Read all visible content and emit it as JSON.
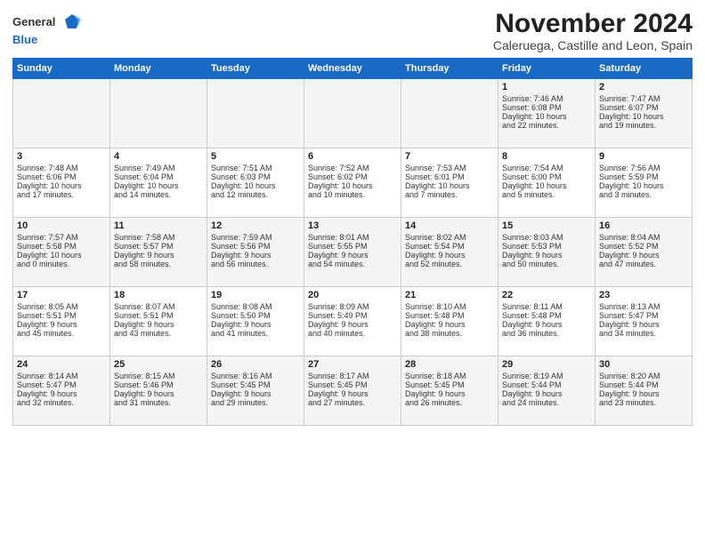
{
  "logo": {
    "general": "General",
    "blue": "Blue"
  },
  "header": {
    "month_title": "November 2024",
    "subtitle": "Caleruega, Castille and Leon, Spain"
  },
  "weekdays": [
    "Sunday",
    "Monday",
    "Tuesday",
    "Wednesday",
    "Thursday",
    "Friday",
    "Saturday"
  ],
  "weeks": [
    [
      {
        "day": "",
        "text": ""
      },
      {
        "day": "",
        "text": ""
      },
      {
        "day": "",
        "text": ""
      },
      {
        "day": "",
        "text": ""
      },
      {
        "day": "",
        "text": ""
      },
      {
        "day": "1",
        "text": "Sunrise: 7:46 AM\nSunset: 6:08 PM\nDaylight: 10 hours\nand 22 minutes."
      },
      {
        "day": "2",
        "text": "Sunrise: 7:47 AM\nSunset: 6:07 PM\nDaylight: 10 hours\nand 19 minutes."
      }
    ],
    [
      {
        "day": "3",
        "text": "Sunrise: 7:48 AM\nSunset: 6:06 PM\nDaylight: 10 hours\nand 17 minutes."
      },
      {
        "day": "4",
        "text": "Sunrise: 7:49 AM\nSunset: 6:04 PM\nDaylight: 10 hours\nand 14 minutes."
      },
      {
        "day": "5",
        "text": "Sunrise: 7:51 AM\nSunset: 6:03 PM\nDaylight: 10 hours\nand 12 minutes."
      },
      {
        "day": "6",
        "text": "Sunrise: 7:52 AM\nSunset: 6:02 PM\nDaylight: 10 hours\nand 10 minutes."
      },
      {
        "day": "7",
        "text": "Sunrise: 7:53 AM\nSunset: 6:01 PM\nDaylight: 10 hours\nand 7 minutes."
      },
      {
        "day": "8",
        "text": "Sunrise: 7:54 AM\nSunset: 6:00 PM\nDaylight: 10 hours\nand 5 minutes."
      },
      {
        "day": "9",
        "text": "Sunrise: 7:56 AM\nSunset: 5:59 PM\nDaylight: 10 hours\nand 3 minutes."
      }
    ],
    [
      {
        "day": "10",
        "text": "Sunrise: 7:57 AM\nSunset: 5:58 PM\nDaylight: 10 hours\nand 0 minutes."
      },
      {
        "day": "11",
        "text": "Sunrise: 7:58 AM\nSunset: 5:57 PM\nDaylight: 9 hours\nand 58 minutes."
      },
      {
        "day": "12",
        "text": "Sunrise: 7:59 AM\nSunset: 5:56 PM\nDaylight: 9 hours\nand 56 minutes."
      },
      {
        "day": "13",
        "text": "Sunrise: 8:01 AM\nSunset: 5:55 PM\nDaylight: 9 hours\nand 54 minutes."
      },
      {
        "day": "14",
        "text": "Sunrise: 8:02 AM\nSunset: 5:54 PM\nDaylight: 9 hours\nand 52 minutes."
      },
      {
        "day": "15",
        "text": "Sunrise: 8:03 AM\nSunset: 5:53 PM\nDaylight: 9 hours\nand 50 minutes."
      },
      {
        "day": "16",
        "text": "Sunrise: 8:04 AM\nSunset: 5:52 PM\nDaylight: 9 hours\nand 47 minutes."
      }
    ],
    [
      {
        "day": "17",
        "text": "Sunrise: 8:05 AM\nSunset: 5:51 PM\nDaylight: 9 hours\nand 45 minutes."
      },
      {
        "day": "18",
        "text": "Sunrise: 8:07 AM\nSunset: 5:51 PM\nDaylight: 9 hours\nand 43 minutes."
      },
      {
        "day": "19",
        "text": "Sunrise: 8:08 AM\nSunset: 5:50 PM\nDaylight: 9 hours\nand 41 minutes."
      },
      {
        "day": "20",
        "text": "Sunrise: 8:09 AM\nSunset: 5:49 PM\nDaylight: 9 hours\nand 40 minutes."
      },
      {
        "day": "21",
        "text": "Sunrise: 8:10 AM\nSunset: 5:48 PM\nDaylight: 9 hours\nand 38 minutes."
      },
      {
        "day": "22",
        "text": "Sunrise: 8:11 AM\nSunset: 5:48 PM\nDaylight: 9 hours\nand 36 minutes."
      },
      {
        "day": "23",
        "text": "Sunrise: 8:13 AM\nSunset: 5:47 PM\nDaylight: 9 hours\nand 34 minutes."
      }
    ],
    [
      {
        "day": "24",
        "text": "Sunrise: 8:14 AM\nSunset: 5:47 PM\nDaylight: 9 hours\nand 32 minutes."
      },
      {
        "day": "25",
        "text": "Sunrise: 8:15 AM\nSunset: 5:46 PM\nDaylight: 9 hours\nand 31 minutes."
      },
      {
        "day": "26",
        "text": "Sunrise: 8:16 AM\nSunset: 5:45 PM\nDaylight: 9 hours\nand 29 minutes."
      },
      {
        "day": "27",
        "text": "Sunrise: 8:17 AM\nSunset: 5:45 PM\nDaylight: 9 hours\nand 27 minutes."
      },
      {
        "day": "28",
        "text": "Sunrise: 8:18 AM\nSunset: 5:45 PM\nDaylight: 9 hours\nand 26 minutes."
      },
      {
        "day": "29",
        "text": "Sunrise: 8:19 AM\nSunset: 5:44 PM\nDaylight: 9 hours\nand 24 minutes."
      },
      {
        "day": "30",
        "text": "Sunrise: 8:20 AM\nSunset: 5:44 PM\nDaylight: 9 hours\nand 23 minutes."
      }
    ]
  ]
}
